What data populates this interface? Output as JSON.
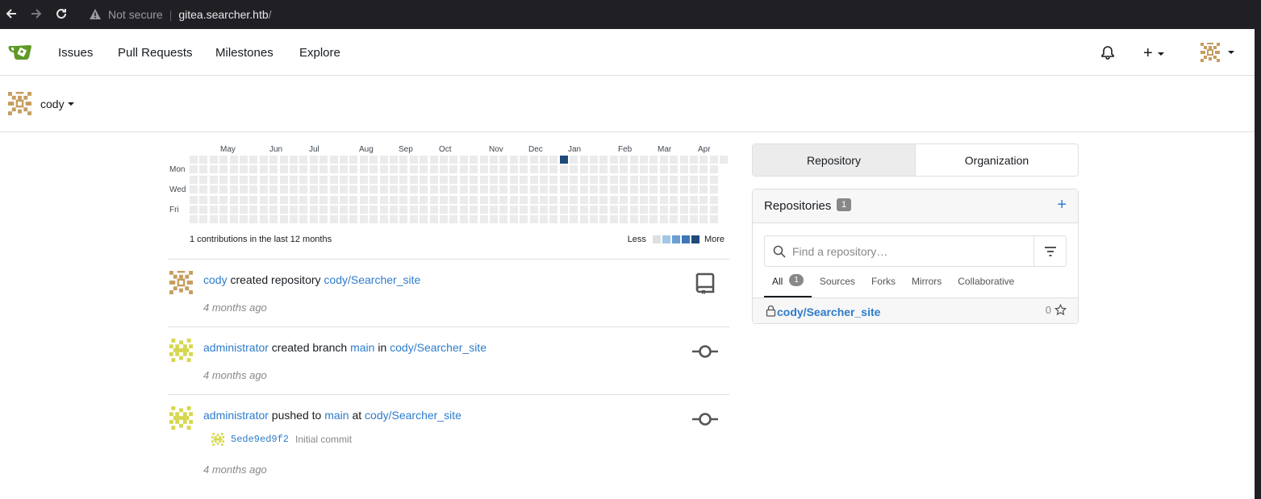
{
  "browser": {
    "security_label": "Not secure",
    "url_host": "gitea.searcher.htb",
    "url_path": "/"
  },
  "navbar": {
    "items": [
      "Issues",
      "Pull Requests",
      "Milestones",
      "Explore"
    ],
    "create_label": "+"
  },
  "context": {
    "username": "cody"
  },
  "heatmap": {
    "months": [
      "May",
      "Jun",
      "Jul",
      "Aug",
      "Sep",
      "Oct",
      "Nov",
      "Dec",
      "Jan",
      "Feb",
      "Mar",
      "Apr"
    ],
    "days": [
      "Mon",
      "Wed",
      "Fri"
    ],
    "summary": "1 contributions in the last 12 months",
    "legend_less": "Less",
    "legend_more": "More",
    "colors": [
      "#e0e0e0",
      "#a4c6e6",
      "#6b9fd4",
      "#3d78b6",
      "#1e4a7a"
    ]
  },
  "feed": [
    {
      "actor": "cody",
      "action": " created repository ",
      "target": "cody/Searcher_site",
      "time": "4 months ago"
    },
    {
      "actor": "administrator",
      "action": " created branch ",
      "branch": "main",
      "in": " in ",
      "target": "cody/Searcher_site",
      "time": "4 months ago"
    },
    {
      "actor": "administrator",
      "action": " pushed to ",
      "branch": "main",
      "at": " at ",
      "target": "cody/Searcher_site",
      "commit_sha": "5ede9ed9f2",
      "commit_msg": "Initial commit",
      "time": "4 months ago"
    }
  ],
  "panel": {
    "tabs": [
      "Repository",
      "Organization"
    ],
    "repos_title": "Repositories",
    "repos_count": "1",
    "add_label": "+",
    "search_placeholder": "Find a repository…",
    "subtabs": [
      "All",
      "Sources",
      "Forks",
      "Mirrors",
      "Collaborative"
    ],
    "all_count": "1",
    "repo_name": "cody/Searcher_site",
    "repo_stars": "0"
  }
}
